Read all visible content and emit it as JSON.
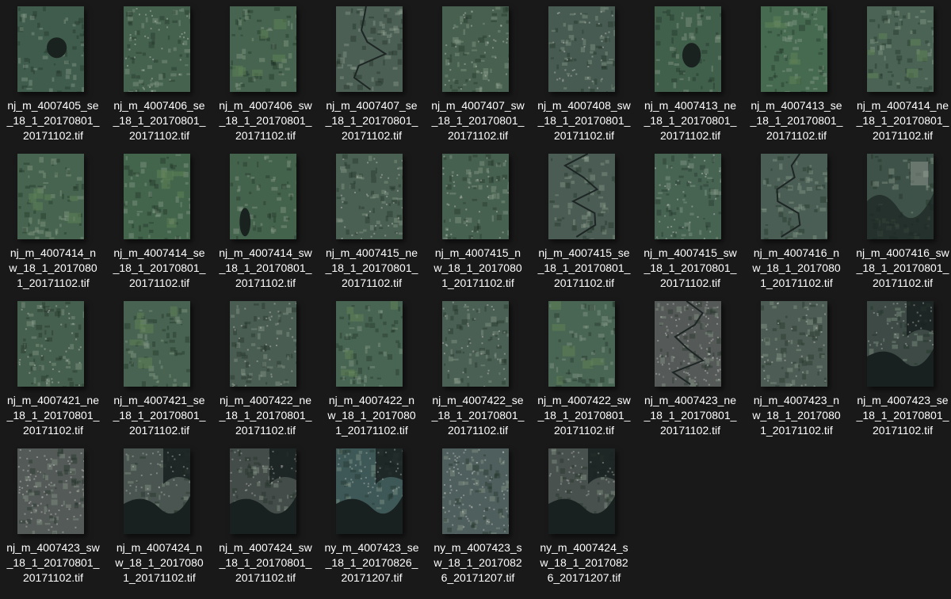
{
  "files": [
    {
      "name": "nj_m_4007405_se_18_1_20170801_20171102.tif",
      "label_lines": [
        "nj_m_4007405_se",
        "_18_1_20170801_",
        "20171102.tif"
      ],
      "thumb": {
        "base": "#3f5c4d",
        "variant": "lake"
      }
    },
    {
      "name": "nj_m_4007406_se_18_1_20170801_20171102.tif",
      "label_lines": [
        "nj_m_4007406_se",
        "_18_1_20170801_",
        "20171102.tif"
      ],
      "thumb": {
        "base": "#44624e",
        "variant": "suburb"
      }
    },
    {
      "name": "nj_m_4007406_sw_18_1_20170801_20171102.tif",
      "label_lines": [
        "nj_m_4007406_sw",
        "_18_1_20170801_",
        "20171102.tif"
      ],
      "thumb": {
        "base": "#46644f",
        "variant": "fields"
      }
    },
    {
      "name": "nj_m_4007407_se_18_1_20170801_20171102.tif",
      "label_lines": [
        "nj_m_4007407_se",
        "_18_1_20170801_",
        "20171102.tif"
      ],
      "thumb": {
        "base": "#4c5f55",
        "variant": "river"
      }
    },
    {
      "name": "nj_m_4007407_sw_18_1_20170801_20171102.tif",
      "label_lines": [
        "nj_m_4007407_sw",
        "_18_1_20170801_",
        "20171102.tif"
      ],
      "thumb": {
        "base": "#48604f",
        "variant": "suburb"
      }
    },
    {
      "name": "nj_m_4007408_sw_18_1_20170801_20171102.tif",
      "label_lines": [
        "nj_m_4007408_sw",
        "_18_1_20170801_",
        "20171102.tif"
      ],
      "thumb": {
        "base": "#475b52",
        "variant": "suburb"
      }
    },
    {
      "name": "nj_m_4007413_ne_18_1_20170801_20171102.tif",
      "label_lines": [
        "nj_m_4007413_ne",
        "_18_1_20170801_",
        "20171102.tif"
      ],
      "thumb": {
        "base": "#41604c",
        "variant": "lake"
      }
    },
    {
      "name": "nj_m_4007413_se_18_1_20170801_20171102.tif",
      "label_lines": [
        "nj_m_4007413_se",
        "_18_1_20170801_",
        "20171102.tif"
      ],
      "thumb": {
        "base": "#456a50",
        "variant": "fields"
      }
    },
    {
      "name": "nj_m_4007414_ne_18_1_20170801_20171102.tif",
      "label_lines": [
        "nj_m_4007414_ne",
        "_18_1_20170801_",
        "20171102.tif"
      ],
      "thumb": {
        "base": "#4a6354",
        "variant": "fields"
      }
    },
    {
      "name": "nj_m_4007414_nw_18_1_20170801_20171102.tif",
      "label_lines": [
        "nj_m_4007414_n",
        "w_18_1_2017080",
        "1_20171102.tif"
      ],
      "thumb": {
        "base": "#46644f",
        "variant": "fields"
      }
    },
    {
      "name": "nj_m_4007414_se_18_1_20170801_20171102.tif",
      "label_lines": [
        "nj_m_4007414_se",
        "_18_1_20170801_",
        "20171102.tif"
      ],
      "thumb": {
        "base": "#42654c",
        "variant": "fields"
      }
    },
    {
      "name": "nj_m_4007414_sw_18_1_20170801_20171102.tif",
      "label_lines": [
        "nj_m_4007414_sw",
        "_18_1_20170801_",
        "20171102.tif"
      ],
      "thumb": {
        "base": "#44634d",
        "variant": "lake"
      }
    },
    {
      "name": "nj_m_4007415_ne_18_1_20170801_20171102.tif",
      "label_lines": [
        "nj_m_4007415_ne",
        "_18_1_20170801_",
        "20171102.tif"
      ],
      "thumb": {
        "base": "#4a6052",
        "variant": "suburb"
      }
    },
    {
      "name": "nj_m_4007415_nw_18_1_20170801_20171102.tif",
      "label_lines": [
        "nj_m_4007415_n",
        "w_18_1_2017080",
        "1_20171102.tif"
      ],
      "thumb": {
        "base": "#476151",
        "variant": "suburb"
      }
    },
    {
      "name": "nj_m_4007415_se_18_1_20170801_20171102.tif",
      "label_lines": [
        "nj_m_4007415_se",
        "_18_1_20170801_",
        "20171102.tif"
      ],
      "thumb": {
        "base": "#4a5c54",
        "variant": "river"
      }
    },
    {
      "name": "nj_m_4007415_sw_18_1_20170801_20171102.tif",
      "label_lines": [
        "nj_m_4007415_sw",
        "_18_1_20170801_",
        "20171102.tif"
      ],
      "thumb": {
        "base": "#476453",
        "variant": "suburb"
      }
    },
    {
      "name": "nj_m_4007416_nw_18_1_20170801_20171102.tif",
      "label_lines": [
        "nj_m_4007416_n",
        "w_18_1_2017080",
        "1_20171102.tif"
      ],
      "thumb": {
        "base": "#4b5e55",
        "variant": "river"
      }
    },
    {
      "name": "nj_m_4007416_sw_18_1_20170801_20171102.tif",
      "label_lines": [
        "nj_m_4007416_sw",
        "_18_1_20170801_",
        "20171102.tif"
      ],
      "thumb": {
        "base": "#3f5249",
        "variant": "wetland"
      }
    },
    {
      "name": "nj_m_4007421_ne_18_1_20170801_20171102.tif",
      "label_lines": [
        "nj_m_4007421_ne",
        "_18_1_20170801_",
        "20171102.tif"
      ],
      "thumb": {
        "base": "#46604f",
        "variant": "suburb"
      }
    },
    {
      "name": "nj_m_4007421_se_18_1_20170801_20171102.tif",
      "label_lines": [
        "nj_m_4007421_se",
        "_18_1_20170801_",
        "20171102.tif"
      ],
      "thumb": {
        "base": "#486351",
        "variant": "fields"
      }
    },
    {
      "name": "nj_m_4007422_ne_18_1_20170801_20171102.tif",
      "label_lines": [
        "nj_m_4007422_ne",
        "_18_1_20170801_",
        "20171102.tif"
      ],
      "thumb": {
        "base": "#4a5d52",
        "variant": "suburb"
      }
    },
    {
      "name": "nj_m_4007422_nw_18_1_20170801_20171102.tif",
      "label_lines": [
        "nj_m_4007422_n",
        "w_18_1_2017080",
        "1_20171102.tif"
      ],
      "thumb": {
        "base": "#476552",
        "variant": "fields"
      }
    },
    {
      "name": "nj_m_4007422_se_18_1_20170801_20171102.tif",
      "label_lines": [
        "nj_m_4007422_se",
        "_18_1_20170801_",
        "20171102.tif"
      ],
      "thumb": {
        "base": "#4b6054",
        "variant": "suburb"
      }
    },
    {
      "name": "nj_m_4007422_sw_18_1_20170801_20171102.tif",
      "label_lines": [
        "nj_m_4007422_sw",
        "_18_1_20170801_",
        "20171102.tif"
      ],
      "thumb": {
        "base": "#496553",
        "variant": "fields"
      }
    },
    {
      "name": "nj_m_4007423_ne_18_1_20170801_20171102.tif",
      "label_lines": [
        "nj_m_4007423_ne",
        "_18_1_20170801_",
        "20171102.tif"
      ],
      "thumb": {
        "base": "#555a58",
        "variant": "city-river"
      }
    },
    {
      "name": "nj_m_4007423_nw_18_1_20170801_20171102.tif",
      "label_lines": [
        "nj_m_4007423_n",
        "w_18_1_2017080",
        "1_20171102.tif"
      ],
      "thumb": {
        "base": "#4d5c55",
        "variant": "suburb"
      }
    },
    {
      "name": "nj_m_4007423_se_18_1_20170801_20171102.tif",
      "label_lines": [
        "nj_m_4007423_se",
        "_18_1_20170801_",
        "20171102.tif"
      ],
      "thumb": {
        "base": "#3d4a46",
        "variant": "harbor"
      }
    },
    {
      "name": "nj_m_4007423_sw_18_1_20170801_20171102.tif",
      "label_lines": [
        "nj_m_4007423_sw",
        "_18_1_20170801_",
        "20171102.tif"
      ],
      "thumb": {
        "base": "#545a58",
        "variant": "city"
      }
    },
    {
      "name": "nj_m_4007424_nw_18_1_20170801_20171102.tif",
      "label_lines": [
        "nj_m_4007424_n",
        "w_18_1_2017080",
        "1_20171102.tif"
      ],
      "thumb": {
        "base": "#4a5551",
        "variant": "harbor"
      }
    },
    {
      "name": "nj_m_4007424_sw_18_1_20170801_20171102.tif",
      "label_lines": [
        "nj_m_4007424_sw",
        "_18_1_20170801_",
        "20171102.tif"
      ],
      "thumb": {
        "base": "#444c4a",
        "variant": "harbor"
      }
    },
    {
      "name": "ny_m_4007423_se_18_1_20170826_20171207.tif",
      "label_lines": [
        "ny_m_4007423_se",
        "_18_1_20170826_",
        "20171207.tif"
      ],
      "thumb": {
        "base": "#3e5858",
        "variant": "harbor"
      }
    },
    {
      "name": "ny_m_4007423_sw_18_1_20170826_20171207.tif",
      "label_lines": [
        "ny_m_4007423_s",
        "w_18_1_2017082",
        "6_20171207.tif"
      ],
      "thumb": {
        "base": "#4f5f5d",
        "variant": "city"
      }
    },
    {
      "name": "ny_m_4007424_sw_18_1_20170826_20171207.tif",
      "label_lines": [
        "ny_m_4007424_s",
        "w_18_1_2017082",
        "6_20171207.tif"
      ],
      "thumb": {
        "base": "#49514f",
        "variant": "harbor"
      }
    }
  ]
}
